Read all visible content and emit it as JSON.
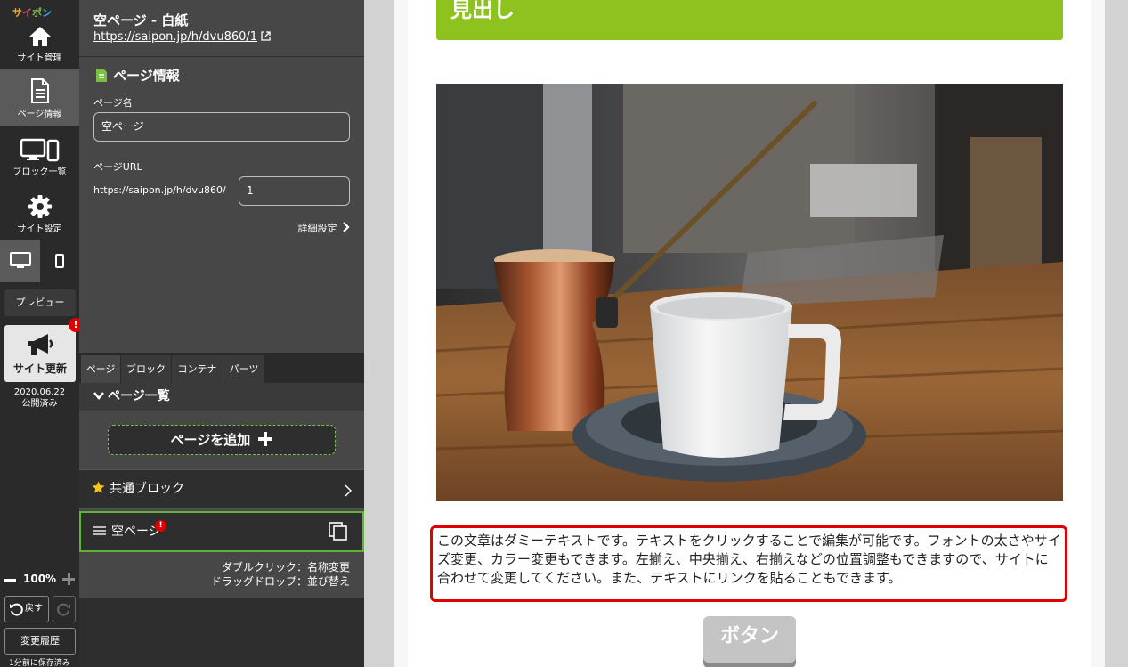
{
  "app": {
    "logo": [
      "サ",
      "イ",
      "ポ",
      "ン"
    ]
  },
  "nav": {
    "site_manage": "サイト管理",
    "page_info": "ページ情報",
    "block_list": "ブロック一覧",
    "site_settings": "サイト設定",
    "preview": "プレビュー",
    "site_update": "サイト更新",
    "alert_mark": "!",
    "publish_date": "2020.06.22",
    "publish_status": "公開済み",
    "zoom": "100%",
    "undo": "戻す",
    "history": "変更履歴",
    "saved_note": "1分前に保存済み"
  },
  "panel": {
    "page_title": "空ページ - 白紙",
    "page_url_link": "https://saipon.jp/h/dvu860/1",
    "section_title": "ページ情報",
    "page_name_label": "ページ名",
    "page_name_value": "空ページ",
    "page_url_label": "ページURL",
    "url_prefix": "https://saipon.jp/h/dvu860/",
    "url_value": "1",
    "detail_link": "詳細設定",
    "tabs": [
      "ページ",
      "ブロック",
      "コンテナ",
      "パーツ"
    ],
    "list_title": "ページ一覧",
    "add_page": "ページを追加",
    "shared_block": "共通ブロック",
    "page_item": "空ページ",
    "hint_line1": "ダブルクリック：名称変更",
    "hint_line2": "ドラッグドロップ：並び替え"
  },
  "canvas": {
    "heading": "見出し",
    "photo_alt": "coffee",
    "body_text": "この文章はダミーテキストです。テキストをクリックすることで編集が可能です。フォントの太さやサイズ変更、カラー変更もできます。左揃え、中央揃え、右揃えなどの位置調整もできますので、サイトに合わせて変更してください。また、テキストにリンクを貼ることもできます。",
    "button_label": "ボタン"
  },
  "colors": {
    "accent_green": "#8dc21f",
    "alert_red": "#e00000",
    "sidebar_dark": "#2a2a2a",
    "panel_gray": "#474747"
  }
}
